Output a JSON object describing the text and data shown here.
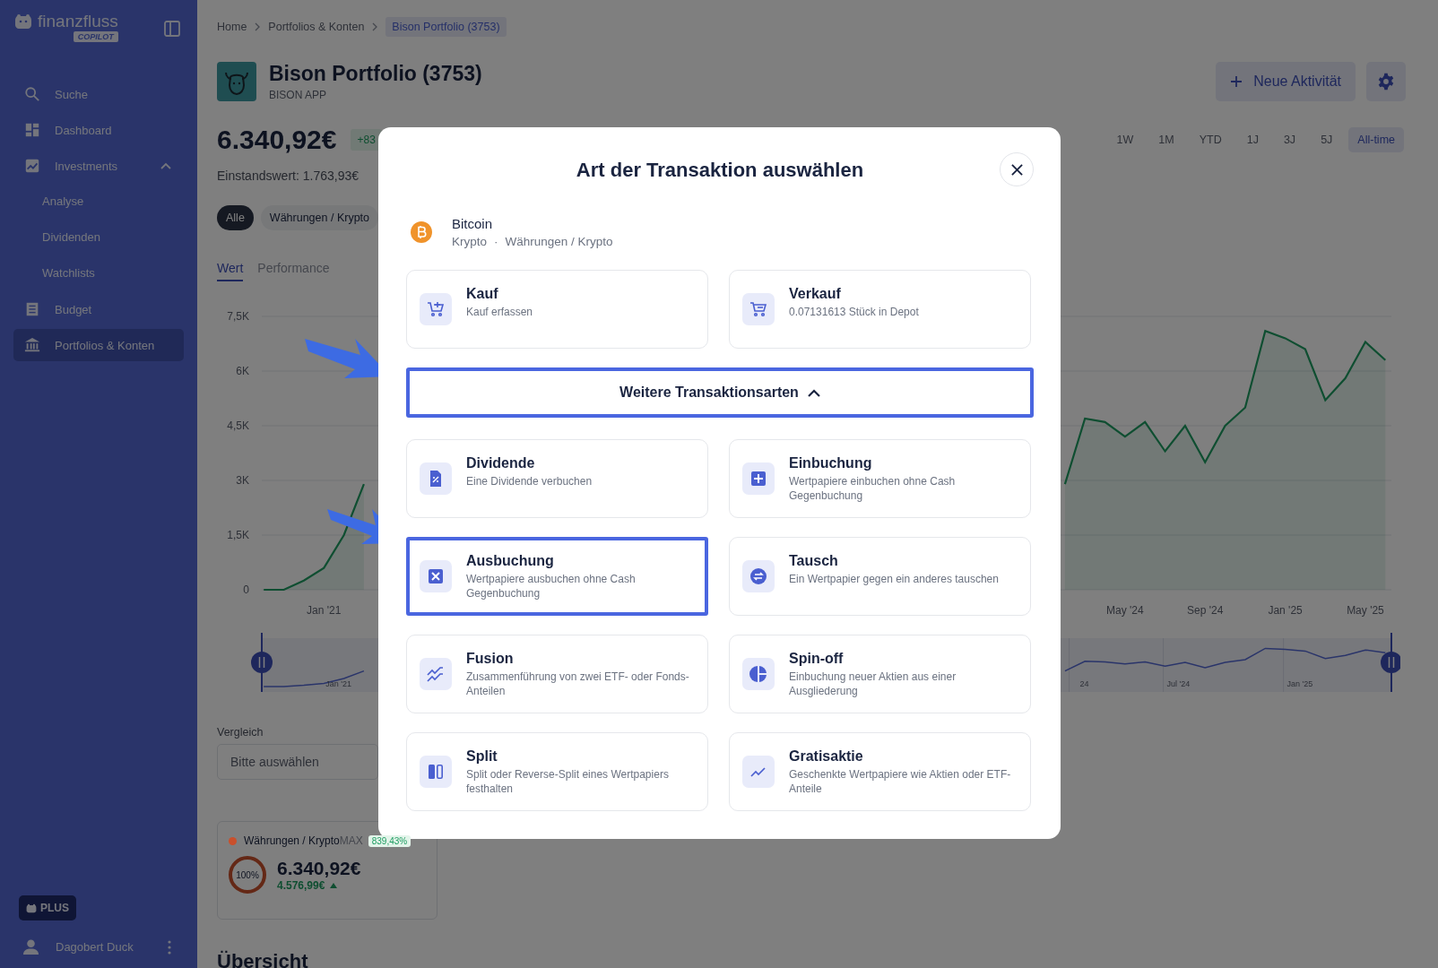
{
  "sidebar": {
    "logo": {
      "name": "finanzfluss",
      "badge": "COPILOT"
    },
    "items": [
      {
        "label": "Suche",
        "selected": false
      },
      {
        "label": "Dashboard",
        "selected": false
      },
      {
        "label": "Investments",
        "selected": false,
        "expanded": true,
        "children": [
          {
            "label": "Analyse",
            "selected": false
          },
          {
            "label": "Dividenden",
            "selected": false
          },
          {
            "label": "Watchlists",
            "selected": false
          }
        ]
      },
      {
        "label": "Budget",
        "selected": false
      },
      {
        "label": "Portfolios & Konten",
        "selected": true
      }
    ],
    "plan_badge": "PLUS",
    "user": "Dagobert Duck"
  },
  "breadcrumb": [
    {
      "label": "Home",
      "current": false
    },
    {
      "label": "Portfolios & Konten",
      "current": false
    },
    {
      "label": "Bison Portfolio (3753)",
      "current": true
    }
  ],
  "portfolio": {
    "title": "Bison Portfolio (3753)",
    "subtitle": "BISON APP",
    "value": "6.340,92€",
    "change_badge": "+83",
    "cost_basis": "Einstandswert: 1.763,93€"
  },
  "actions": {
    "new_activity": "Neue Aktivität"
  },
  "ranges": [
    {
      "label": "1W",
      "selected": false
    },
    {
      "label": "1M",
      "selected": false
    },
    {
      "label": "YTD",
      "selected": false
    },
    {
      "label": "1J",
      "selected": false
    },
    {
      "label": "3J",
      "selected": false
    },
    {
      "label": "5J",
      "selected": false
    },
    {
      "label": "All-time",
      "selected": true
    }
  ],
  "filters": [
    {
      "label": "Alle",
      "selected": true
    },
    {
      "label": "Währungen / Krypto",
      "selected": false
    }
  ],
  "tabs": [
    {
      "label": "Wert",
      "selected": true
    },
    {
      "label": "Performance",
      "selected": false
    }
  ],
  "chart_data": {
    "type": "area",
    "grid": true,
    "ylim": [
      0,
      7500
    ],
    "categories": [
      null,
      null,
      null,
      "Jan '21",
      null,
      null,
      null,
      null,
      null,
      null,
      null,
      null,
      null,
      null,
      null,
      null,
      null,
      null,
      null,
      null,
      null,
      null,
      null,
      null,
      null,
      null,
      null,
      null,
      null,
      null,
      null,
      null,
      null,
      null,
      null,
      null,
      null,
      null,
      null,
      null,
      null,
      null,
      null,
      "May '24",
      null,
      null,
      null,
      "Sep '24",
      null,
      null,
      null,
      "Jan '25",
      null,
      null,
      null,
      "May '25",
      null
    ],
    "yticks": [
      {
        "value": 0,
        "label": "0"
      },
      {
        "value": 1500,
        "label": "1,5K"
      },
      {
        "value": 3000,
        "label": "3K"
      },
      {
        "value": 4500,
        "label": "4,5K"
      },
      {
        "value": 6000,
        "label": "6K"
      },
      {
        "value": 7500,
        "label": "7,5K"
      }
    ],
    "series": [
      {
        "color": "#1f9d62",
        "values": [
          0,
          0,
          250,
          600,
          1500,
          2900,
          null,
          null,
          null,
          null,
          null,
          null,
          null,
          null,
          null,
          null,
          null,
          null,
          null,
          null,
          null,
          null,
          null,
          null,
          null,
          null,
          null,
          null,
          null,
          null,
          null,
          null,
          null,
          null,
          null,
          null,
          null,
          null,
          null,
          null,
          2900,
          4700,
          4600,
          4200,
          4600,
          3800,
          4500,
          3500,
          4500,
          5000,
          7100,
          6900,
          6600,
          5200,
          5800,
          6800,
          6300
        ]
      }
    ]
  },
  "navigator": {
    "labels": [
      "Jan '21",
      "24",
      "Jul '24",
      "Jan '25"
    ]
  },
  "compare": {
    "label": "Vergleich",
    "placeholder": "Bitte auswählen"
  },
  "holding": {
    "name": "Währungen / Krypto",
    "suffix": "MAX",
    "badge": "839,43%",
    "color": "#c9502c",
    "share": "100%",
    "value": "6.340,92€",
    "gain": "4.576,99€"
  },
  "overview_title": "Übersicht",
  "modal": {
    "title": "Art der Transaktion auswählen",
    "asset": {
      "name": "Bitcoin",
      "type": "Krypto",
      "separator": "·",
      "category": "Währungen / Krypto"
    },
    "primary": [
      {
        "title": "Kauf",
        "desc": "Kauf erfassen",
        "highlighted": false
      },
      {
        "title": "Verkauf",
        "desc": "0.07131613 Stück in Depot",
        "highlighted": false
      }
    ],
    "more": {
      "label": "Weitere Transaktionsarten",
      "expanded": true,
      "highlighted": true
    },
    "others": [
      {
        "title": "Dividende",
        "desc": "Eine Dividende verbuchen",
        "highlighted": false
      },
      {
        "title": "Einbuchung",
        "desc": "Wertpapiere einbuchen ohne Cash Gegenbuchung",
        "highlighted": false
      },
      {
        "title": "Ausbuchung",
        "desc": "Wertpapiere ausbuchen ohne Cash Gegenbuchung",
        "highlighted": true
      },
      {
        "title": "Tausch",
        "desc": "Ein Wertpapier gegen ein anderes tauschen",
        "highlighted": false
      },
      {
        "title": "Fusion",
        "desc": "Zusammenführung von zwei ETF- oder Fonds-Anteilen",
        "highlighted": false
      },
      {
        "title": "Spin-off",
        "desc": "Einbuchung neuer Aktien aus einer Ausgliederung",
        "highlighted": false
      },
      {
        "title": "Split",
        "desc": "Split oder Reverse-Split eines Wertpapiers festhalten",
        "highlighted": false
      },
      {
        "title": "Gratisaktie",
        "desc": "Geschenkte Wertpapiere wie Aktien oder ETF-Anteile",
        "highlighted": false
      }
    ]
  }
}
